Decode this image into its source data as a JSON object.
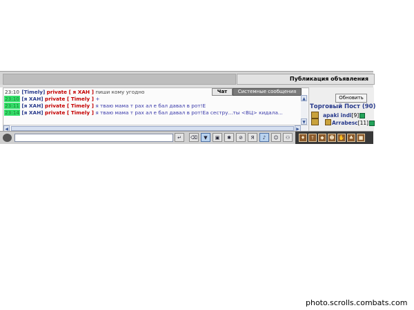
{
  "header": {
    "publication_title": "Публикация объявления"
  },
  "chat": {
    "tabs": [
      {
        "label": "Чат",
        "active": true
      },
      {
        "label": "Системные сообщения",
        "active": false
      }
    ],
    "messages": [
      {
        "time": "23:10",
        "highlight": false,
        "nick": "[Timely]",
        "private": "private [ я ХАН ]",
        "text": "пиши кому угодно"
      },
      {
        "time": "23:10",
        "highlight": true,
        "nick": "[я ХАН]",
        "private": "private [ Timely ]",
        "text": "+"
      },
      {
        "time": "23:11",
        "highlight": true,
        "nick": "[я ХАН]",
        "private": "private [ Timely ]",
        "text": "я тваю мама т рах ал е бал давал в рот!Е"
      },
      {
        "time": "23:14",
        "highlight": true,
        "nick": "[я ХАН]",
        "private": "private [ Timely ]",
        "text": "я тваю мама т рах ал е бал давал в рот!Еа сестру...ты <ВЦ> кидала..."
      }
    ]
  },
  "right_panel": {
    "refresh_label": "Обновить",
    "post_title": "Торговый Пост (90)",
    "players": [
      {
        "name": "apaki indi",
        "level": "[9]"
      },
      {
        "name": "Arrabesc",
        "level": "[11]"
      }
    ]
  },
  "toolbar": {
    "chat_input_value": "",
    "send_icon": "enter-arrow-icon"
  },
  "watermark": "photo.scrolls.combats.com",
  "colors": {
    "nick": "#283a8c",
    "private": "#c40000",
    "time_highlight": "#34e06a"
  }
}
